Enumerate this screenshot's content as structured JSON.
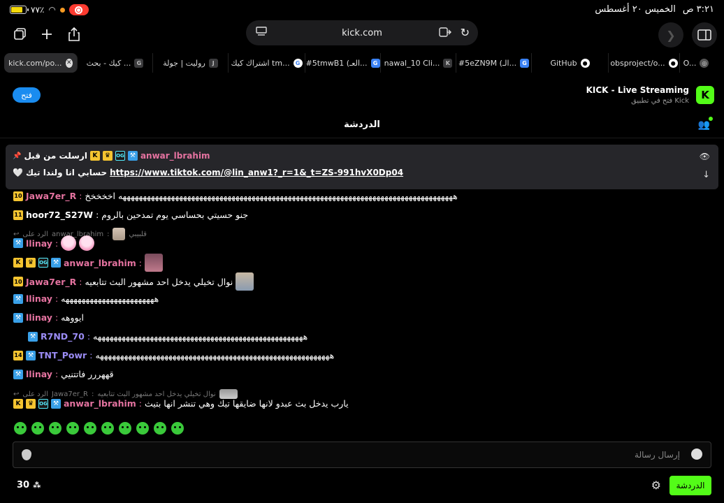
{
  "status_bar": {
    "battery_text": "٧٧٪",
    "battery_level": 0.77,
    "time": "٣:٢١ ص",
    "date": "الخميس ٢٠ أغسطس"
  },
  "browser": {
    "url": "kick.com",
    "tabs": [
      {
        "label": "kick.com/po...",
        "active": true
      },
      {
        "label": "كيك - بحث ...",
        "favicon": "G"
      },
      {
        "label": "روليت | جولة",
        "favicon": "J"
      },
      {
        "label": "اشتراك كيك tm...",
        "favicon": "google"
      },
      {
        "label": "#5tmwB1 (العـ...",
        "favicon": "G"
      },
      {
        "label": "nawal_10 Cli...",
        "favicon": "K"
      },
      {
        "label": "#5eZN9M (الـ...",
        "favicon": "G"
      },
      {
        "label": "GitHub",
        "favicon": "github"
      },
      {
        "label": "obsproject/o...",
        "favicon": "github"
      },
      {
        "label": "O...",
        "favicon": "obs"
      }
    ]
  },
  "banner": {
    "open_label": "فتح",
    "app_name": "KICK - Live Streaming",
    "app_subtitle": "فتح في تطبيق Kick",
    "logo_letter": "K"
  },
  "chat": {
    "title": "الدردشة",
    "pinned": {
      "username": "anwar_lbrahim",
      "sent_by": "ارسلت من قبل",
      "link": "https://www.tiktok.com/@lin_anw1?_r=1&_t=ZS-991hvX0Dp04",
      "text": "حسابي انا ولندا تيك"
    },
    "messages": [
      {
        "user": "Jawa7er_R",
        "badge": "10",
        "text": "هههههههههههههههههههههههههههههههههههههههههههههههههههههههههههههههههههههههههههههههههههه اخخخخخ"
      },
      {
        "user": "hoor72_S27W",
        "badge": "11",
        "text": "جنو حسيتي بحساسي يوم تمدحين بالروم"
      },
      {
        "reply_to": "anwar_lbrahim",
        "reply_label": "الرد على",
        "reply_text": "قلبيبي"
      },
      {
        "user": "llinay",
        "text": ""
      },
      {
        "user": "anwar_lbrahim",
        "text": ""
      },
      {
        "user": "Jawa7er_R",
        "badge": "10",
        "text": "نوال تخيلي يدخل احد مشهور البث تتابعيه"
      },
      {
        "user": "llinay",
        "text": "هههههههههههههههههههههههه"
      },
      {
        "user": "llinay",
        "text": "ايووهه"
      },
      {
        "user": "R7ND_70",
        "text": "ههههههههههههههههههههههههههههههههههههههههههههههههههههه"
      },
      {
        "user": "TNT_Powr",
        "badge": "14",
        "text": "ههههههههههههههههههههههههههههههههههههههههههههههههههههههههههه"
      },
      {
        "user": "llinay",
        "text": "قههررر فاتتنيي"
      },
      {
        "reply_to": "Jawa7er_R",
        "reply_label": "الرد على",
        "reply_text": "نوال تخيلي يدخل احد مشهور البث تتابعيه"
      },
      {
        "user": "anwar_lbrahim",
        "text": "يارب يدخل بث عبدو لانها ضايقها تيك وهي تنشر انها بتيث"
      }
    ],
    "input_placeholder": "إرسال رسالة",
    "viewer_count": "30",
    "send_label": "الدردشة"
  },
  "colors": {
    "kick_green": "#53fc18",
    "username_pink": "#e573a0",
    "username_purple": "#9b8cf5",
    "open_blue": "#1a8cf0",
    "pinned_bg": "#26262a"
  }
}
